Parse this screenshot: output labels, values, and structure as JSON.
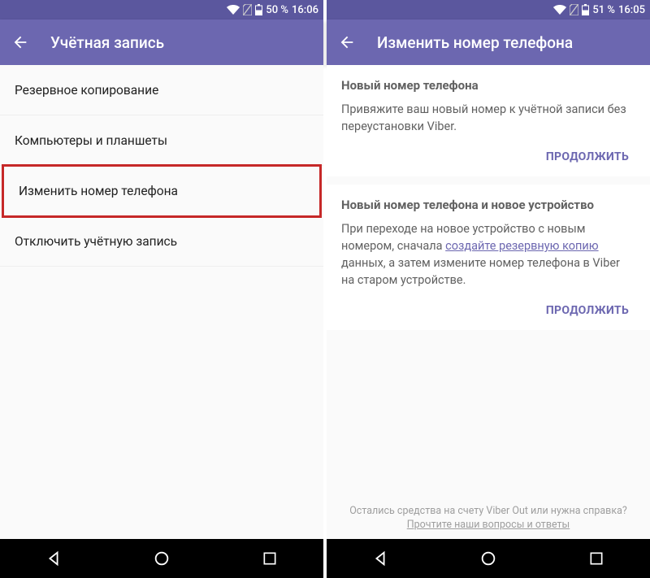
{
  "left": {
    "status": {
      "battery": "50 %",
      "time": "16:06"
    },
    "title": "Учётная запись",
    "items": [
      {
        "label": "Резервное копирование",
        "highlight": false
      },
      {
        "label": "Компьютеры и планшеты",
        "highlight": false
      },
      {
        "label": "Изменить номер телефона",
        "highlight": true
      },
      {
        "label": "Отключить учётную запись",
        "highlight": false
      }
    ]
  },
  "right": {
    "status": {
      "battery": "51 %",
      "time": "16:05"
    },
    "title": "Изменить номер телефона",
    "card1": {
      "title": "Новый номер телефона",
      "body": "Привяжите ваш новый номер к учётной записи без переустановки Viber.",
      "action": "ПРОДОЛЖИТЬ"
    },
    "card2": {
      "title": "Новый номер телефона и новое устройство",
      "body_pre": "При переходе на новое устройство с новым номером, сначала ",
      "body_link": "создайте резервную копию",
      "body_post": " данных, а затем измените номер телефона в Viber на старом устройстве.",
      "action": "ПРОДОЛЖИТЬ"
    },
    "footer": {
      "text": "Остались средства на счету Viber Out или нужна справка?",
      "faq": "Прочтите наши вопросы и ответы"
    }
  }
}
